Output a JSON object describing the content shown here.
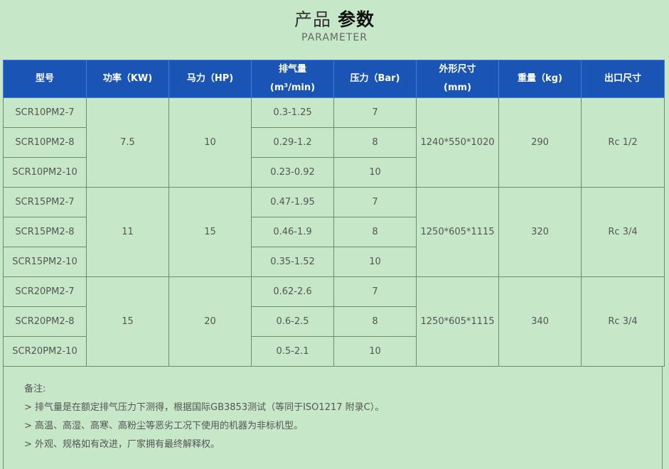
{
  "header": {
    "title_light": "产品",
    "title_bold": "参数",
    "subtitle": "PARAMETER"
  },
  "table": {
    "columns": [
      {
        "label": "型号",
        "unit": ""
      },
      {
        "label": "功率（KW)",
        "unit": ""
      },
      {
        "label": "马力（HP)",
        "unit": ""
      },
      {
        "label": "排气量",
        "unit": "(m³/min)"
      },
      {
        "label": "压力（Bar)",
        "unit": ""
      },
      {
        "label": "外形尺寸",
        "unit": "(mm)"
      },
      {
        "label": "重量（kg)",
        "unit": ""
      },
      {
        "label": "出口尺寸",
        "unit": ""
      }
    ],
    "groups": [
      {
        "power_kw": "7.5",
        "horsepower": "10",
        "dimensions": "1240*550*1020",
        "weight": "290",
        "outlet": "Rc 1/2",
        "rows": [
          {
            "model": "SCR10PM2-7",
            "air": "0.3-1.25",
            "pressure": "7"
          },
          {
            "model": "SCR10PM2-8",
            "air": "0.29-1.2",
            "pressure": "8"
          },
          {
            "model": "SCR10PM2-10",
            "air": "0.23-0.92",
            "pressure": "10"
          }
        ]
      },
      {
        "power_kw": "11",
        "horsepower": "15",
        "dimensions": "1250*605*1115",
        "weight": "320",
        "outlet": "Rc 3/4",
        "rows": [
          {
            "model": "SCR15PM2-7",
            "air": "0.47-1.95",
            "pressure": "7"
          },
          {
            "model": "SCR15PM2-8",
            "air": "0.46-1.9",
            "pressure": "8"
          },
          {
            "model": "SCR15PM2-10",
            "air": "0.35-1.52",
            "pressure": "10"
          }
        ]
      },
      {
        "power_kw": "15",
        "horsepower": "20",
        "dimensions": "1250*605*1115",
        "weight": "340",
        "outlet": "Rc 3/4",
        "rows": [
          {
            "model": "SCR20PM2-7",
            "air": "0.62-2.6",
            "pressure": "7"
          },
          {
            "model": "SCR20PM2-8",
            "air": "0.6-2.5",
            "pressure": "8"
          },
          {
            "model": "SCR20PM2-10",
            "air": "0.5-2.1",
            "pressure": "10"
          }
        ]
      }
    ]
  },
  "notes": {
    "heading": "备注:",
    "items": [
      "> 排气量是在额定排气压力下测得，根据国际GB3853测试（等同于ISO1217 附录C）。",
      "> 高温、高湿、高寒、高粉尘等恶劣工况下使用的机器为非标机型。",
      "> 外观、规格如有改进，厂家拥有最终解释权。"
    ]
  }
}
